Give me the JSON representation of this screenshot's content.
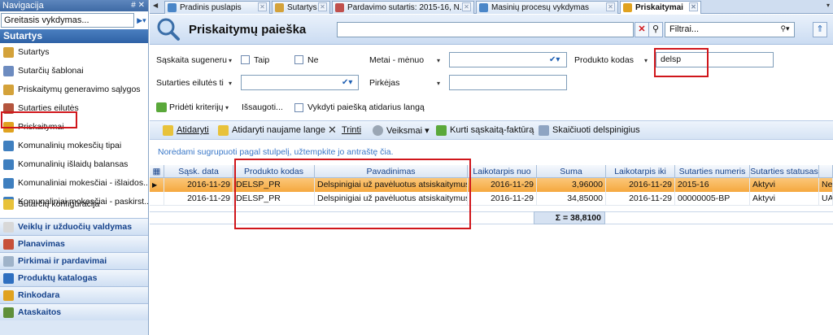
{
  "nav": {
    "title": "Navigacija",
    "header_buttons": "# ✕",
    "quick_search": "Greitasis vykdymas...",
    "section_title": "Sutartys",
    "items": [
      {
        "label": "Sutartys",
        "color": "#d4a23a"
      },
      {
        "label": "Sutarčių šablonai",
        "color": "#6d8cc0"
      },
      {
        "label": "Priskaitymų generavimo sąlygos",
        "color": "#d4a23a"
      },
      {
        "label": "Sutarties eilutės",
        "color": "#b4553e"
      },
      {
        "label": "Priskaitymai",
        "color": "#e0a21f"
      },
      {
        "label": "Komunalinių mokesčių tipai",
        "color": "#3f7fbf"
      },
      {
        "label": "Komunalinių išlaidų balansas",
        "color": "#3f7fbf"
      },
      {
        "label": "Komunaliniai mokesčiai - išlaidos...",
        "color": "#3f7fbf"
      },
      {
        "label": "Komunaliniai mokesčiai - paskirst...",
        "color": "#3f7fbf"
      },
      {
        "label": "Sutarčių konfigūracija",
        "color": "#e8c23a"
      }
    ],
    "modules": [
      {
        "label": "Veiklų ir užduočių valdymas",
        "color": "#d8d8d8"
      },
      {
        "label": "Planavimas",
        "color": "#c7503a"
      },
      {
        "label": "Pirkimai ir pardavimai",
        "color": "#9fb3c9"
      },
      {
        "label": "Produktų katalogas",
        "color": "#2e6fc0"
      },
      {
        "label": "Rinkodara",
        "color": "#e0a21f"
      },
      {
        "label": "Ataskaitos",
        "color": "#5f8f3a"
      }
    ]
  },
  "tabs": [
    {
      "label": "Pradinis puslapis",
      "color": "#4a86c8"
    },
    {
      "label": "Sutartys",
      "color": "#d4a23a"
    },
    {
      "label": "Pardavimo sutartis: 2015-16, N...",
      "color": "#c0504d"
    },
    {
      "label": "Masinių procesų vykdymas",
      "color": "#4a86c8"
    },
    {
      "label": "Priskaitymai",
      "color": "#e0a21f"
    }
  ],
  "header": {
    "title": "Priskaitymų paieška",
    "search_value": "",
    "filter_placeholder": "Filtrai..."
  },
  "criteria": {
    "saskaita_label": "Sąskaita sugeneru",
    "taip_label": "Taip",
    "ne_label": "Ne",
    "metai_label": "Metai - mėnuo",
    "metai_value": "",
    "produkto_label": "Produkto kodas",
    "produkto_value": "delsp",
    "eilutes_label": "Sutarties eilutės ti",
    "eilutes_value": "",
    "pirkejas_label": "Pirkėjas",
    "pirkejas_value": "",
    "prideti_label": "Pridėti kriterijų",
    "issaugoti_label": "Išsaugoti...",
    "vykdyti_label": "Vykdyti paiešką atidarius langą"
  },
  "toolbar": {
    "atidaryti": "Atidaryti",
    "atidaryti_nauja": "Atidaryti naujame lange",
    "trinti": "Trinti",
    "veiksmai": "Veiksmai",
    "kurti": "Kurti sąskaitą-faktūrą",
    "skaiciuoti": "Skaičiuoti delspinigius"
  },
  "group_hint": "Norėdami sugrupuoti pagal stulpelį, užtempkite jo antraštę čia.",
  "grid": {
    "columns": [
      "Sąsk. data",
      "Produkto kodas",
      "Pavadinimas",
      "Laikotarpis nuo",
      "Suma",
      "Laikotarpis iki",
      "Sutarties numeris",
      "Sutarties statusas",
      ""
    ],
    "rows": [
      [
        "2016-11-29",
        "DELSP_PR",
        "Delspinigiai už pavėluotus atsiskaitymus",
        "2016-11-29",
        "3,96000",
        "2016-11-29",
        "2015-16",
        "Aktyvi",
        "Ne"
      ],
      [
        "2016-11-29",
        "DELSP_PR",
        "Delspinigiai už pavėluotus atsiskaitymus",
        "2016-11-29",
        "34,85000",
        "2016-11-29",
        "00000005-BP",
        "Aktyvi",
        "UA"
      ]
    ],
    "sum_label": "Σ = 38,8100"
  }
}
